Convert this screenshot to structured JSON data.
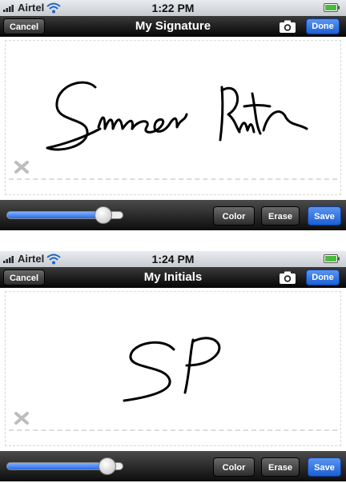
{
  "screens": [
    {
      "status": {
        "carrier": "Airtel",
        "time": "1:22 PM"
      },
      "nav": {
        "cancel": "Cancel",
        "title": "My Signature",
        "done": "Done"
      },
      "toolbar": {
        "color": "Color",
        "erase": "Erase",
        "save": "Save",
        "stroke_width_fraction": 0.83
      }
    },
    {
      "status": {
        "carrier": "Airtel",
        "time": "1:24 PM"
      },
      "nav": {
        "cancel": "Cancel",
        "title": "My Initials",
        "done": "Done"
      },
      "toolbar": {
        "color": "Color",
        "erase": "Erase",
        "save": "Save",
        "stroke_width_fraction": 0.86
      }
    }
  ],
  "icons": {
    "signal": "signal-bars-icon",
    "wifi": "wifi-icon",
    "battery": "battery-icon",
    "camera": "camera-icon",
    "sign_here": "x-mark-icon"
  },
  "colors": {
    "accent": "#2b6be6",
    "navbar": "#1a1a1a",
    "ink": "#000000"
  }
}
